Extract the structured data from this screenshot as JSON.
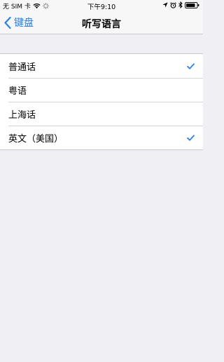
{
  "status_bar": {
    "carrier": "无 SIM 卡",
    "time": "下午9:10",
    "icons": [
      "wifi-icon",
      "loading-icon",
      "location-icon",
      "alarm-icon",
      "bluetooth-icon",
      "battery-icon"
    ]
  },
  "nav": {
    "back_label": "键盘",
    "title": "听写语言"
  },
  "colors": {
    "accent": "#2a7ff0",
    "background": "#efeff4",
    "cell": "#ffffff"
  },
  "languages": [
    {
      "label": "普通话",
      "checked": true
    },
    {
      "label": "粤语",
      "checked": false
    },
    {
      "label": "上海话",
      "checked": false
    },
    {
      "label": "英文（美国）",
      "checked": true
    }
  ]
}
